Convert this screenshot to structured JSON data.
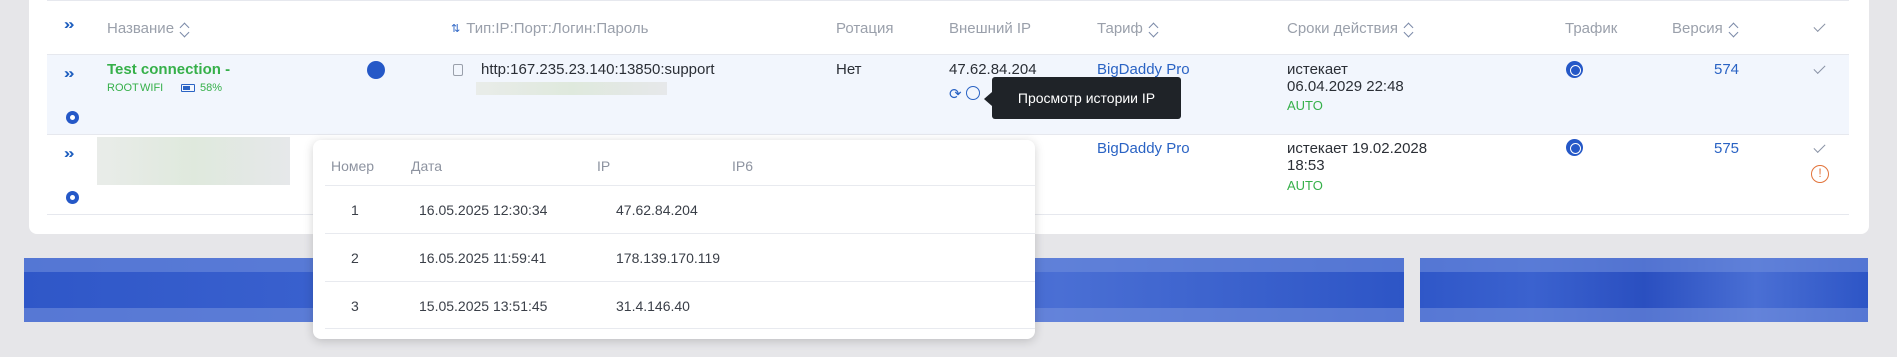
{
  "header": {
    "name": "Название",
    "type": "Тип:IP:Порт:Логин:Пароль",
    "rotation": "Ротация",
    "external_ip": "Внешний IP",
    "tariff": "Тариф",
    "validity": "Сроки действия",
    "traffic": "Трафик",
    "version": "Версия"
  },
  "row1": {
    "name": "Test connection -",
    "tag_root": "ROOT",
    "tag_wifi": "WIFI",
    "battery": "58%",
    "proxy": "http:167.235.23.140:13850:support",
    "rotation": "Нет",
    "ip": "47.62.84.204",
    "tariff": "BigDaddy Pro",
    "expires_label": "истекает",
    "expires_date": "06.04.2029 22:48",
    "mode": "AUTO",
    "version": "574"
  },
  "row2": {
    "tariff": "BigDaddy Pro",
    "expires_line1": "истекает 19.02.2028",
    "expires_line2": "18:53",
    "mode": "AUTO",
    "version": "575"
  },
  "tooltip": "Просмотр истории IP",
  "history": {
    "columns": [
      "Номер",
      "Дата",
      "IP",
      "IP6"
    ],
    "rows": [
      {
        "n": "1",
        "date": "16.05.2025 12:30:34",
        "ip": "47.62.84.204"
      },
      {
        "n": "2",
        "date": "16.05.2025 11:59:41",
        "ip": "178.139.170.119"
      },
      {
        "n": "3",
        "date": "15.05.2025 13:51:45",
        "ip": "31.4.146.40"
      }
    ]
  },
  "colors": {
    "accent": "#2a63c4",
    "green": "#36b04a",
    "warning": "#e2733a"
  }
}
